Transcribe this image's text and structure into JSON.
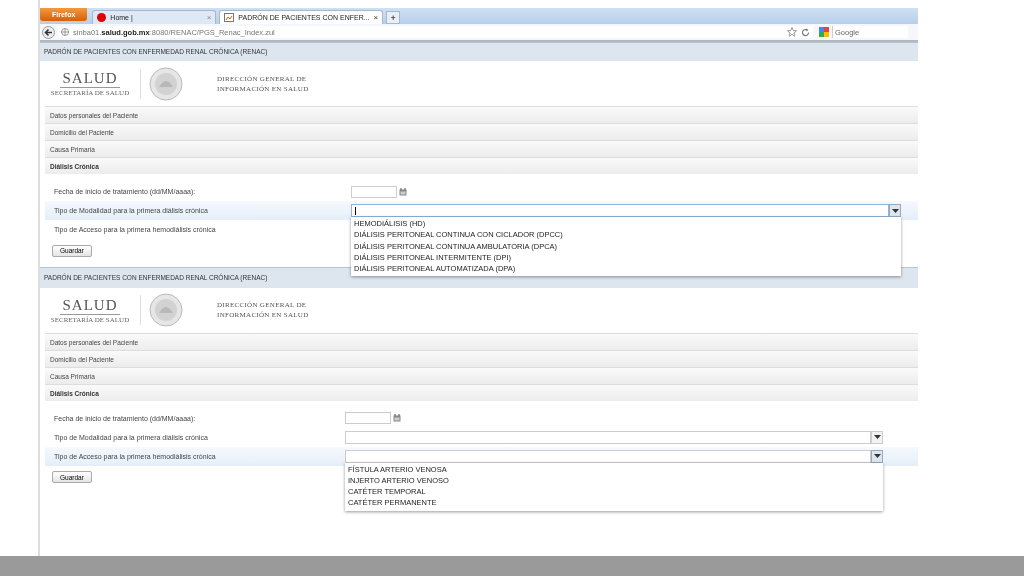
{
  "browser": {
    "menu_button": "Firefox",
    "tabs": [
      {
        "title": "Home |",
        "close": "×",
        "selected": false
      },
      {
        "title": "PADRÓN DE PACIENTES CON ENFER...",
        "close": "×",
        "selected": true
      }
    ],
    "new_tab": "+",
    "url": "sinba01.**salud.gob.mx**:8080/RENAC/PGS_Renac_Index.zul",
    "search_placeholder": "Google"
  },
  "panels": [
    {
      "title": "PADRÓN DE PACIENTES CON ENFERMEDAD RENAL CRÓNICA (RENAC)",
      "logo": {
        "name": "SALUD",
        "subtitle": "SECRETARÍA DE SALUD",
        "agency_lines": [
          "DIRECCIÓN GENERAL DE",
          "INFORMACIÓN EN SALUD"
        ]
      },
      "sections": [
        {
          "label": "Datos personales del Paciente",
          "expanded": false
        },
        {
          "label": "Domicilio del Paciente",
          "expanded": false
        },
        {
          "label": "Causa Primaria",
          "expanded": false
        },
        {
          "label": "Diálisis Crónica",
          "expanded": true
        }
      ],
      "rows": [
        {
          "label": "Fecha de inicio de tratamiento (dd/MM/aaaa):",
          "highlighted": false,
          "field": {
            "kind": "date"
          }
        },
        {
          "label": "Tipo de Modalidad para la primera diálisis crónica",
          "highlighted": true,
          "field": {
            "kind": "combo",
            "focused": true,
            "open": true,
            "options": [
              "HEMODIÁLISIS (HD)",
              "DIÁLISIS PERITONEAL CONTINUA CON CICLADOR (DPCC)",
              "DIÁLISIS PERITONEAL CONTINUA AMBULATORIA (DPCA)",
              "DIÁLISIS PERITONEAL INTERMITENTE (DPI)",
              "DIÁLISIS PERITONEAL AUTOMATIZADA (DPA)"
            ]
          }
        },
        {
          "label": "Tipo de Acceso para la primera hemodiálisis crónica",
          "highlighted": false
        }
      ],
      "button": "Guardar"
    },
    {
      "title": "PADRÓN DE PACIENTES CON ENFERMEDAD RENAL CRÓNICA (RENAC)",
      "logo": {
        "name": "SALUD",
        "subtitle": "SECRETARÍA DE SALUD",
        "agency_lines": [
          "DIRECCIÓN GENERAL DE",
          "INFORMACIÓN EN SALUD"
        ]
      },
      "sections": [
        {
          "label": "Datos personales del Paciente",
          "expanded": false
        },
        {
          "label": "Domicilio del Paciente",
          "expanded": false
        },
        {
          "label": "Causa Primaria",
          "expanded": false
        },
        {
          "label": "Diálisis Crónica",
          "expanded": true
        }
      ],
      "rows": [
        {
          "label": "Fecha de inicio de tratamiento (dd/MM/aaaa):",
          "highlighted": false,
          "field": {
            "kind": "date"
          }
        },
        {
          "label": "Tipo de Modalidad para la primera diálisis crónica",
          "highlighted": false,
          "field": {
            "kind": "combo",
            "focused": false,
            "open": false
          }
        },
        {
          "label": "Tipo de Acceso para la primera hemodiálisis crónica",
          "highlighted": true,
          "field": {
            "kind": "combo",
            "focused": false,
            "open": true,
            "options": [
              "FÍSTULA ARTERIO VENOSA",
              "INJERTO ARTERIO VENOSO",
              "CATÉTER TEMPORAL",
              "CATÉTER PERMANENTE"
            ]
          }
        }
      ],
      "button": "Guardar"
    }
  ]
}
